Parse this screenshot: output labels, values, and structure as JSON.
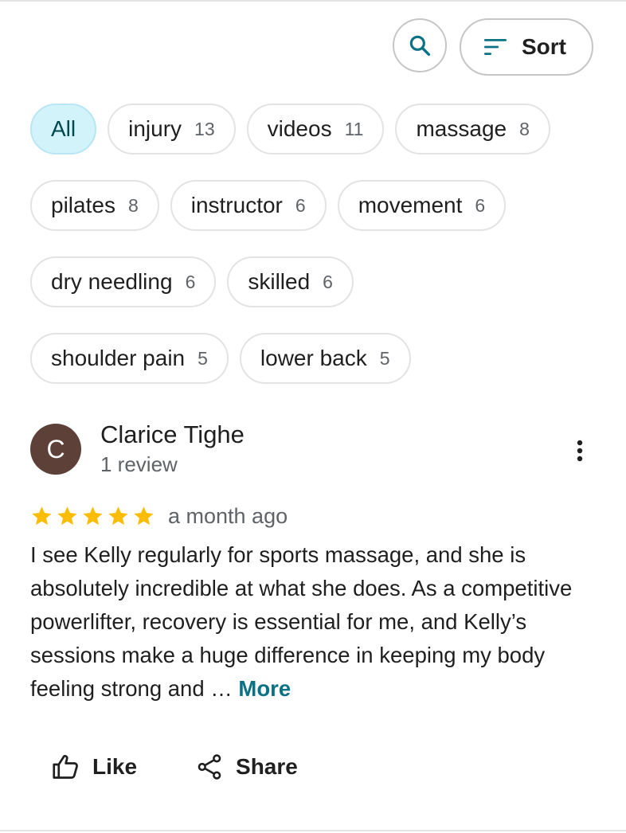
{
  "toolbar": {
    "search_icon": "search-icon",
    "sort_icon": "sort-icon",
    "sort_label": "Sort",
    "accent": "#0b7285"
  },
  "chips": [
    {
      "label": "All",
      "count": "",
      "active": true
    },
    {
      "label": "injury",
      "count": "13"
    },
    {
      "label": "videos",
      "count": "11"
    },
    {
      "label": "massage",
      "count": "8"
    },
    {
      "label": "pilates",
      "count": "8"
    },
    {
      "label": "instructor",
      "count": "6"
    },
    {
      "label": "movement",
      "count": "6"
    },
    {
      "label": "dry needling",
      "count": "6"
    },
    {
      "label": "skilled",
      "count": "6"
    },
    {
      "label": "shoulder pain",
      "count": "5"
    },
    {
      "label": "lower back",
      "count": "5"
    }
  ],
  "review": {
    "avatar_letter": "C",
    "avatar_color": "#5d4037",
    "author": "Clarice Tighe",
    "meta": "1 review",
    "rating": 5,
    "star_color": "#fbbc04",
    "time": "a month ago",
    "text": "I see Kelly regularly for sports massage, and she is absolutely incredible at what she does. As a competitive powerlifter, recovery is essential for me, and Kelly’s sessions make a huge difference in keeping my body feeling strong and … ",
    "more_label": "More",
    "like_label": "Like",
    "share_label": "Share"
  }
}
